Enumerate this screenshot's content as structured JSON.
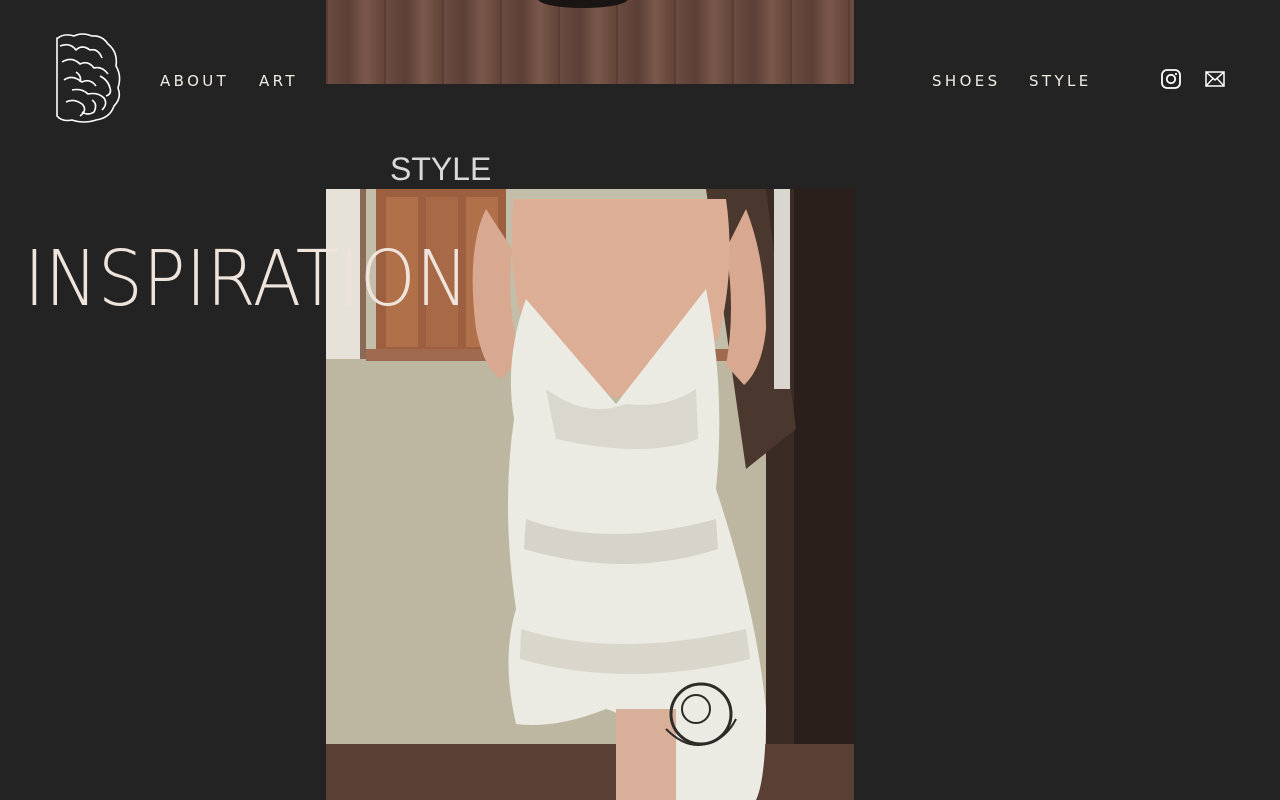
{
  "nav": {
    "left": [
      {
        "label": "ABOUT"
      },
      {
        "label": "ART"
      }
    ],
    "right": [
      {
        "label": "SHOES"
      },
      {
        "label": "STYLE"
      }
    ]
  },
  "social": {
    "instagram_icon": "instagram-icon",
    "email_icon": "mail-icon"
  },
  "hero": {
    "section_label": "STYLE",
    "title": "INSPIRATION"
  },
  "colors": {
    "background": "#232323",
    "nav_text": "#f0ece4",
    "title_text": "#efe4dc",
    "label_text": "#d9d9d9"
  }
}
